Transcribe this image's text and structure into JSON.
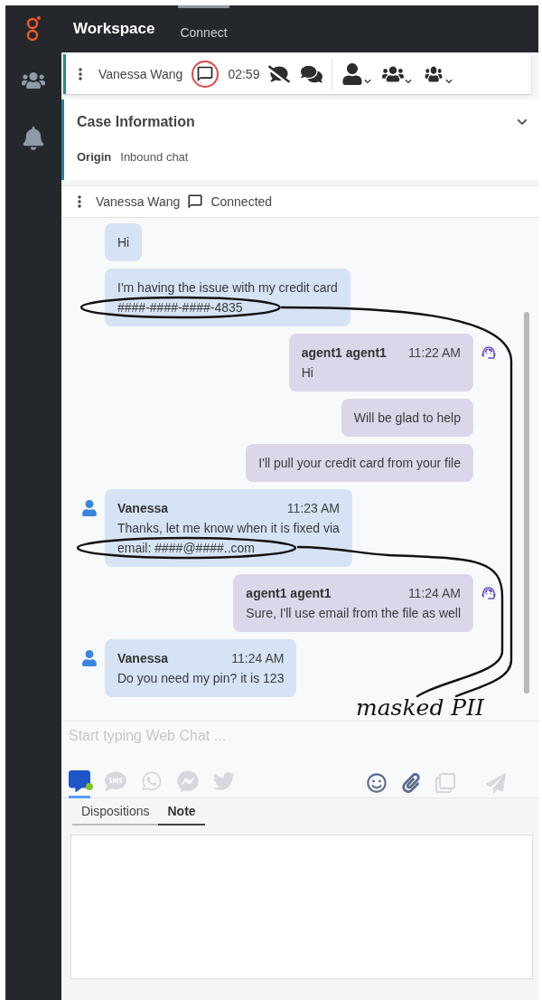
{
  "app_title": "Workspace",
  "tabs": [
    {
      "label": "Connect",
      "selected": true
    }
  ],
  "interaction": {
    "contact": "Vanessa Wang",
    "timer": "02:59"
  },
  "case_information": {
    "title": "Case Information",
    "expanded": true,
    "fields": [
      {
        "label": "Origin",
        "value": "Inbound chat"
      }
    ]
  },
  "party": {
    "name": "Vanessa Wang",
    "status": "Connected"
  },
  "messages": [
    {
      "kind": "customer",
      "text": "Hi"
    },
    {
      "kind": "customer",
      "text": "I'm having the issue with my credit card\n####-####-####-4835",
      "circled": true
    },
    {
      "kind": "agent",
      "name": "agent1 agent1",
      "time": "11:22 AM",
      "text": "Hi"
    },
    {
      "kind": "agent",
      "text": "Will be glad to help"
    },
    {
      "kind": "agent",
      "text": "I'll pull your credit card from your file"
    },
    {
      "kind": "customer",
      "name": "Vanessa",
      "time": "11:23 AM",
      "text": "Thanks, let me know when it is fixed via\nemail: ####@####..com",
      "circled": true
    },
    {
      "kind": "agent",
      "name": "agent1 agent1",
      "time": "11:24 AM",
      "text": "Sure, I'll use email from the file as well"
    },
    {
      "kind": "customer",
      "name": "Vanessa",
      "time": "11:24 AM",
      "text": "Do you need my pin? it is 123"
    }
  ],
  "composer": {
    "placeholder": "Start typing Web Chat ..."
  },
  "channels": [
    {
      "kind": "webchat",
      "selected": true
    },
    {
      "kind": "sms",
      "selected": false
    },
    {
      "kind": "whatsapp",
      "selected": false
    },
    {
      "kind": "messenger",
      "selected": false
    },
    {
      "kind": "twitter",
      "selected": false
    }
  ],
  "bottom_tabs": [
    {
      "label": "Dispositions",
      "selected": false
    },
    {
      "label": "Note",
      "selected": true
    }
  ],
  "annotation": {
    "label": "masked PII"
  }
}
